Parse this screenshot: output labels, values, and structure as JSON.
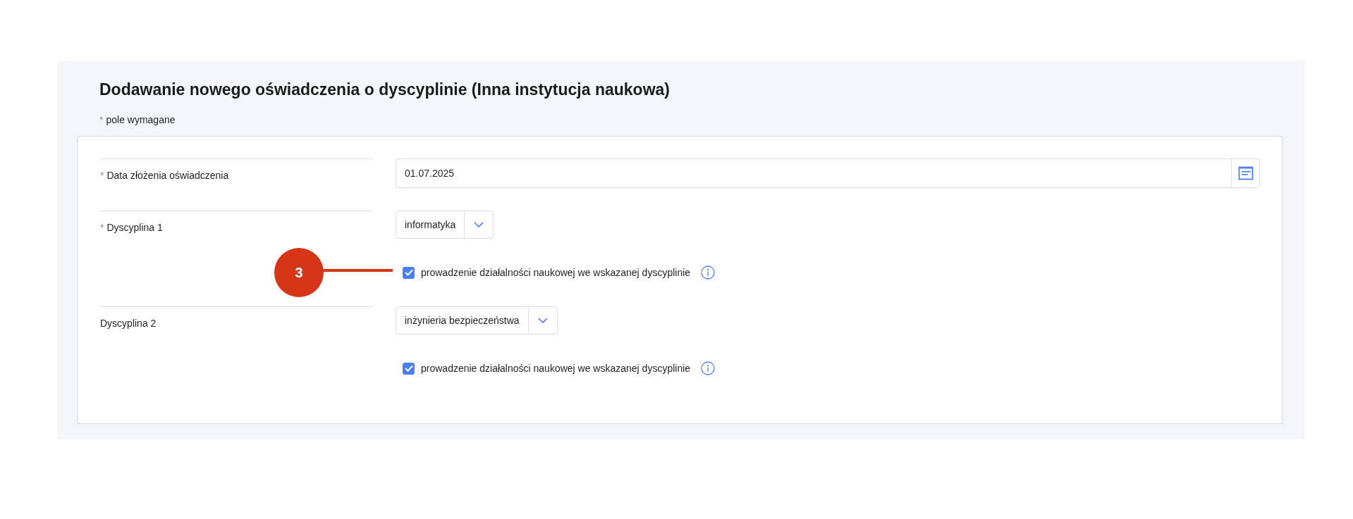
{
  "title": "Dodawanie nowego oświadczenia o dyscyplinie (Inna instytucja naukowa)",
  "required_note": {
    "marker": "*",
    "text": "pole wymagane"
  },
  "rows": [
    {
      "kind": "date",
      "label": "Data złożenia oświadczenia",
      "required": true,
      "value": "01.07.2025"
    },
    {
      "kind": "select",
      "label": "Dyscyplina 1",
      "required": true,
      "value": "informatyka",
      "checkbox": {
        "label": "prowadzenie działalności naukowej we wskazanej dyscyplinie",
        "checked": true
      }
    },
    {
      "kind": "select",
      "label": "Dyscyplina 2",
      "required": false,
      "value": "inżynieria bezpieczeństwa",
      "checkbox": {
        "label": "prowadzenie działalności naukowej we wskazanej dyscyplinie",
        "checked": true
      }
    }
  ],
  "callout": {
    "number": "3"
  }
}
